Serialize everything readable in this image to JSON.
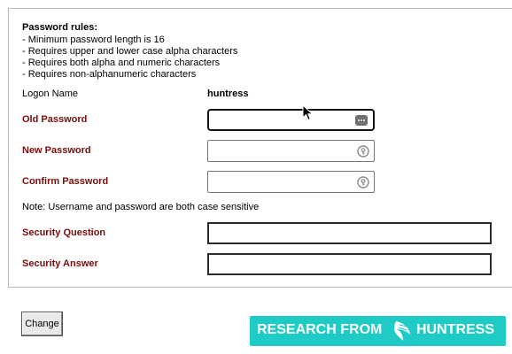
{
  "rules": {
    "title": "Password rules:",
    "items": [
      "- Minimum password length is 16",
      "- Requires upper and lower case alpha characters",
      "- Requires both alpha and numeric characters",
      "- Requires non-alphanumeric characters"
    ]
  },
  "form": {
    "logon_name_label": "Logon Name",
    "logon_name_value": "huntress",
    "old_password_label": "Old Password",
    "old_password_value": "",
    "new_password_label": "New Password",
    "new_password_value": "",
    "confirm_password_label": "Confirm Password",
    "confirm_password_value": "",
    "note": "Note: Username and password are both case sensitive",
    "security_question_label": "Security Question",
    "security_question_value": "",
    "security_answer_label": "Security Answer",
    "security_answer_value": "",
    "change_button": "Change"
  },
  "banner": {
    "text": "RESEARCH FROM",
    "brand": "HUNTRESS",
    "color": "#1ecbc5"
  },
  "colors": {
    "required_label": "#7a0c0c"
  },
  "icons": {
    "old_password": "password-manager-dots-icon",
    "new_password": "password-key-icon",
    "confirm_password": "password-key-icon",
    "cursor": "mouse-pointer-icon",
    "logo": "huntress-logo-icon"
  }
}
